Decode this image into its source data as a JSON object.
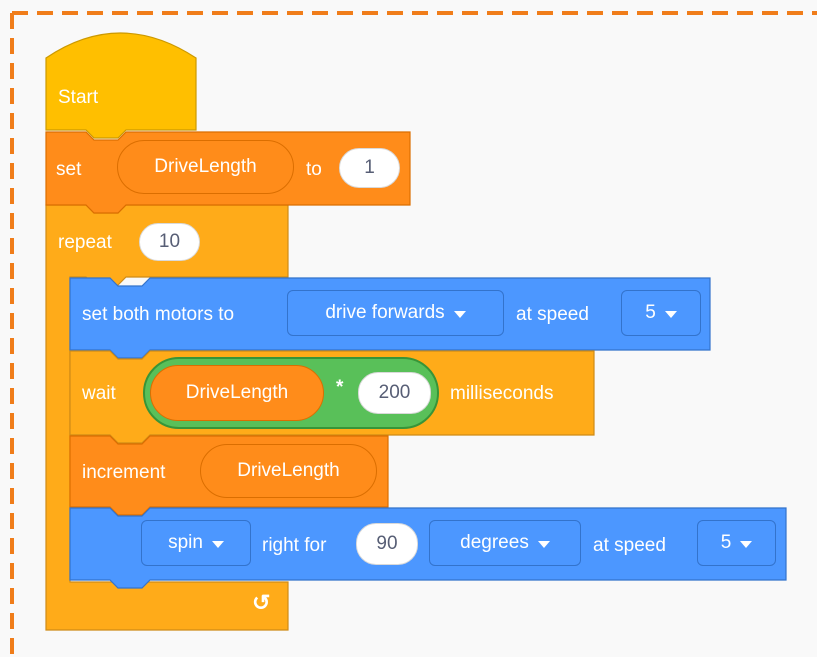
{
  "hat": {
    "label": "Start"
  },
  "set_block": {
    "label": "set",
    "variable": "DriveLength",
    "to_label": "to",
    "value": "1"
  },
  "repeat_block": {
    "label": "repeat",
    "count": "10",
    "loop_arrow": "↺"
  },
  "motors_block": {
    "label": "set both motors to",
    "direction": "drive forwards",
    "speed_label": "at speed",
    "speed": "5"
  },
  "wait_block": {
    "label": "wait",
    "variable": "DriveLength",
    "operator": "*",
    "operand": "200",
    "unit": "milliseconds"
  },
  "increment_block": {
    "label": "increment",
    "variable": "DriveLength"
  },
  "spin_block": {
    "action": "spin",
    "direction_label": "right for",
    "amount": "90",
    "unit": "degrees",
    "speed_label": "at speed",
    "speed": "5"
  },
  "colors": {
    "workspace": "#f9f9f9",
    "border": "#f07d1a",
    "events": "#ffbf00",
    "variables": "#ff8c1a",
    "control": "#ffab19",
    "motion": "#4c97ff",
    "operators": "#59c059"
  },
  "icons": {
    "dropdown": "caret-down-icon",
    "loop": "loop-arrow-icon"
  }
}
